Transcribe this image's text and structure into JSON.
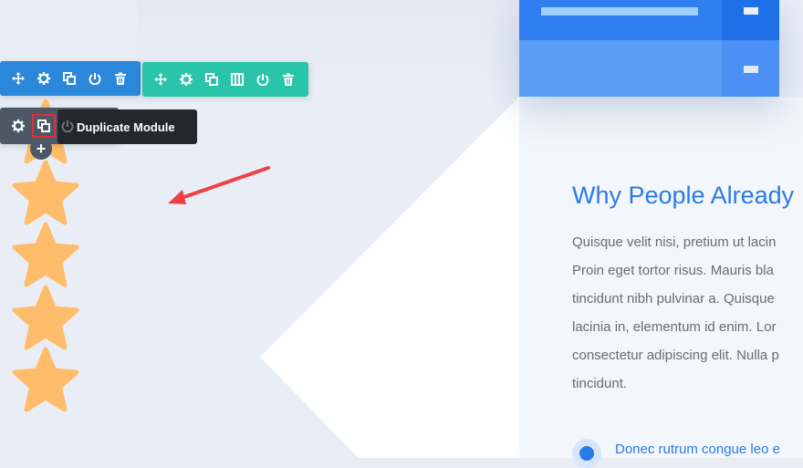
{
  "toolbar_row": {
    "tools": [
      "move-icon",
      "gear-icon",
      "duplicate-icon",
      "power-icon",
      "trash-icon"
    ],
    "column_tools": [
      "move-icon",
      "gear-icon",
      "duplicate-icon",
      "columns-icon",
      "power-icon",
      "trash-icon"
    ]
  },
  "module_toolbar": {
    "tools": [
      "gear-icon",
      "duplicate-icon"
    ],
    "tooltip": "Duplicate Module",
    "add_label": "+"
  },
  "content": {
    "heading": "Why People Already",
    "paragraph_lines": [
      "Quisque velit nisi, pretium ut lacin",
      "Proin eget tortor risus. Mauris bla",
      "tincidunt nibh pulvinar a. Quisque",
      "lacinia in, elementum id enim. Lor",
      "consectetur adipiscing elit. Nulla p",
      "tincidunt."
    ],
    "bullet_text": "Donec rutrum congue leo e"
  },
  "colors": {
    "row_toolbar": "#2b87da",
    "column_toolbar": "#29c4a9",
    "module_toolbar": "#4c5866",
    "highlight": "#e0313a",
    "star": "#ffbd6b",
    "accent": "#2b7be5"
  }
}
